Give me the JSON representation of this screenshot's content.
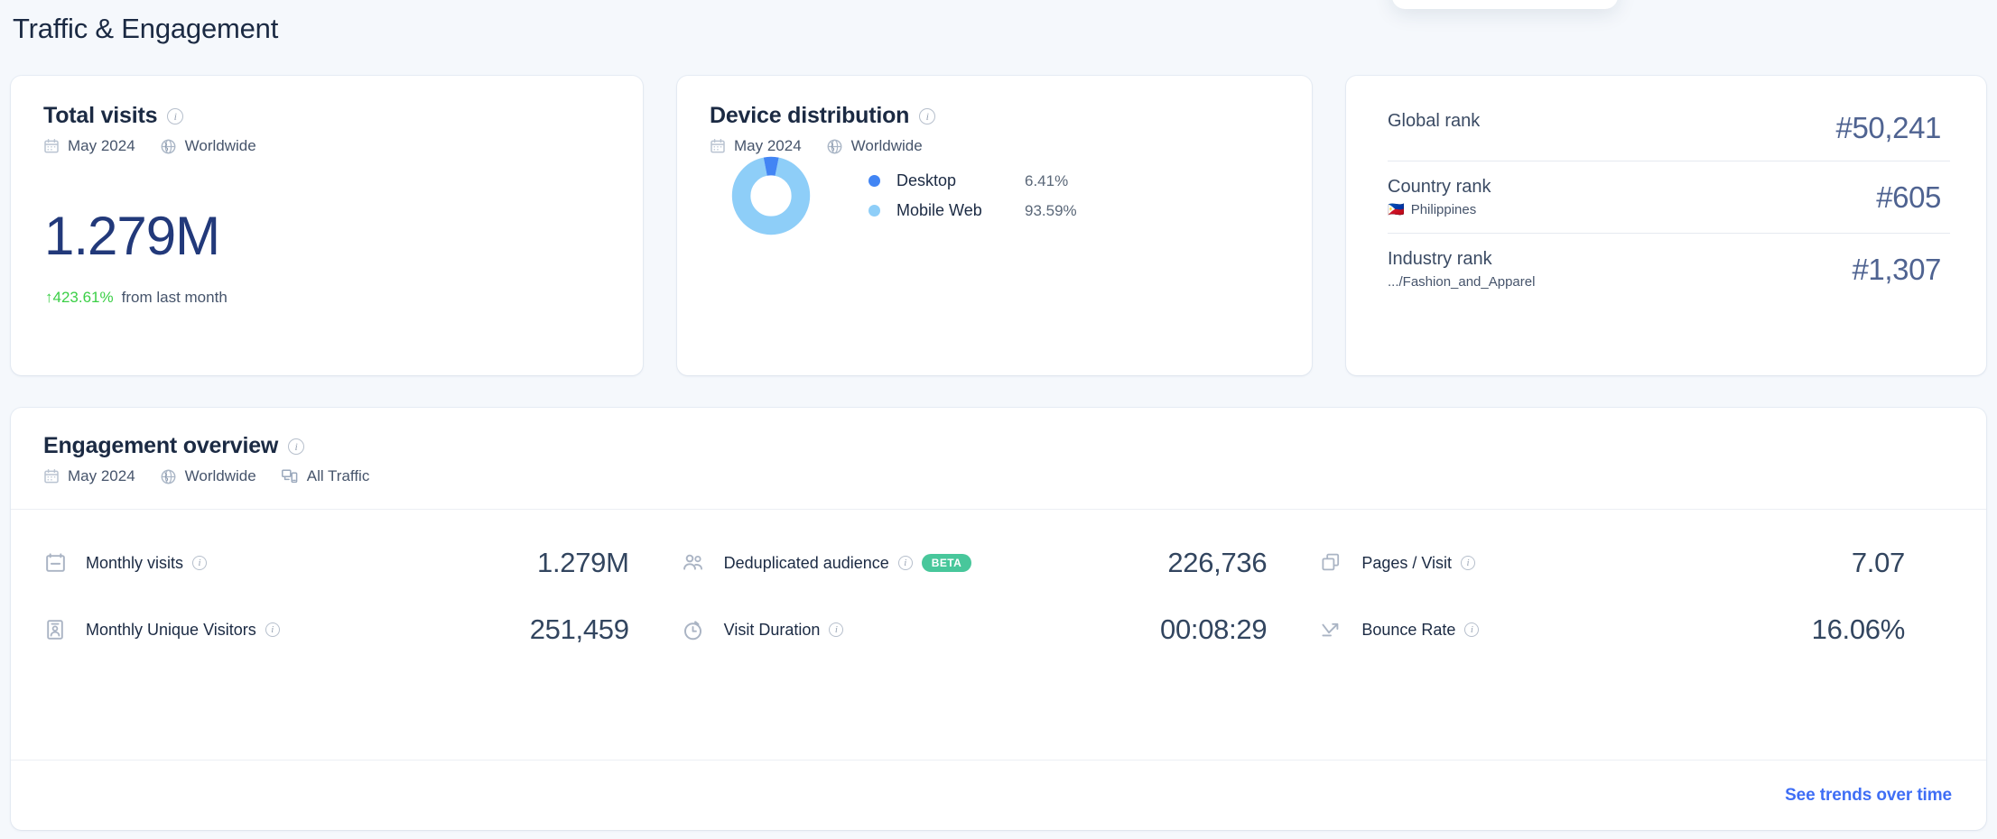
{
  "page": {
    "title": "Traffic & Engagement"
  },
  "colors": {
    "accent_blue": "#3f6ef5",
    "desktop": "#4285f4",
    "mobile": "#8ecef8",
    "positive_green": "#3bcf46",
    "beta_badge": "#48c79b",
    "value_navy": "#22397a",
    "background": "#f5f8fc"
  },
  "total_visits_card": {
    "title": "Total visits",
    "info_icon": "info-icon",
    "meta": {
      "calendar_icon": "calendar-icon",
      "date": "May 2024",
      "globe_icon": "globe-icon",
      "region": "Worldwide"
    },
    "value": "1.279M",
    "delta": {
      "arrow": "↑",
      "percent": "423.61%",
      "label": "from last month"
    }
  },
  "device_card": {
    "title": "Device distribution",
    "info_icon": "info-icon",
    "meta": {
      "calendar_icon": "calendar-icon",
      "date": "May 2024",
      "globe_icon": "globe-icon",
      "region": "Worldwide"
    },
    "legend": [
      {
        "name": "Desktop",
        "value": "6.41%",
        "color": "#4285f4"
      },
      {
        "name": "Mobile Web",
        "value": "93.59%",
        "color": "#8ecef8"
      }
    ]
  },
  "rank_card": {
    "rows": [
      {
        "label": "Global rank",
        "sub": "",
        "flag": "",
        "value": "#50,241"
      },
      {
        "label": "Country rank",
        "sub": "Philippines",
        "flag": "🇵🇭",
        "value": "#605"
      },
      {
        "label": "Industry rank",
        "sub": ".../Fashion_and_Apparel",
        "flag": "",
        "value": "#1,307"
      }
    ]
  },
  "engagement_card": {
    "title": "Engagement overview",
    "info_icon": "info-icon",
    "meta": {
      "calendar_icon": "calendar-icon",
      "date": "May 2024",
      "globe_icon": "globe-icon",
      "region": "Worldwide",
      "devices_icon": "devices-icon",
      "traffic": "All Traffic"
    },
    "metrics": [
      {
        "icon": "calendar-metric-icon",
        "label": "Monthly visits",
        "badge": "",
        "value": "1.279M"
      },
      {
        "icon": "audience-icon",
        "label": "Deduplicated audience",
        "badge": "BETA",
        "value": "226,736"
      },
      {
        "icon": "pages-icon",
        "label": "Pages / Visit",
        "badge": "",
        "value": "7.07"
      },
      {
        "icon": "id-card-icon",
        "label": "Monthly Unique Visitors",
        "badge": "",
        "value": "251,459"
      },
      {
        "icon": "stopwatch-icon",
        "label": "Visit Duration",
        "badge": "",
        "value": "00:08:29"
      },
      {
        "icon": "bounce-arrow-icon",
        "label": "Bounce Rate",
        "badge": "",
        "value": "16.06%"
      }
    ],
    "footer_link": "See trends over time"
  },
  "chart_data": {
    "type": "pie",
    "title": "Device distribution",
    "subtitle": "May 2024 · Worldwide",
    "categories": [
      "Desktop",
      "Mobile Web"
    ],
    "values": [
      6.41,
      93.59
    ],
    "unit": "%",
    "colors": [
      "#4285f4",
      "#8ecef8"
    ],
    "legend_position": "right",
    "donut": true,
    "start_angle_deg": 0
  }
}
